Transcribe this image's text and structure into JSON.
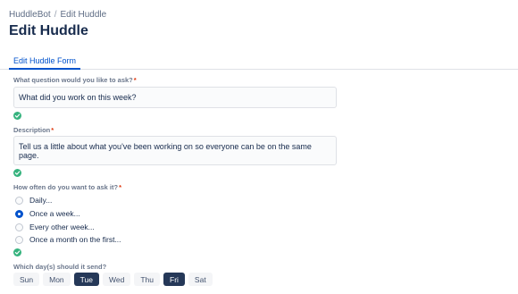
{
  "breadcrumb": {
    "root": "HuddleBot",
    "separator": "/",
    "current": "Edit Huddle"
  },
  "page": {
    "title": "Edit Huddle"
  },
  "tabs": [
    {
      "label": "Edit Huddle Form",
      "active": true
    }
  ],
  "question": {
    "label": "What question would you like to ask?",
    "required_mark": "*",
    "value": "What did you work on this week?",
    "valid": true
  },
  "description": {
    "label": "Description",
    "required_mark": "*",
    "value": "Tell us a little about what you've been working on so everyone can be on the same page.",
    "valid": true
  },
  "frequency": {
    "label": "How often do you want to ask it?",
    "required_mark": "*",
    "options": [
      {
        "label": "Daily...",
        "selected": false
      },
      {
        "label": "Once a week...",
        "selected": true
      },
      {
        "label": "Every other week...",
        "selected": false
      },
      {
        "label": "Once a month on the first...",
        "selected": false
      }
    ],
    "valid": true
  },
  "days": {
    "label": "Which day(s) should it send?",
    "options": [
      {
        "label": "Sun",
        "selected": false
      },
      {
        "label": "Mon",
        "selected": false
      },
      {
        "label": "Tue",
        "selected": true
      },
      {
        "label": "Wed",
        "selected": false
      },
      {
        "label": "Thu",
        "selected": false
      },
      {
        "label": "Fri",
        "selected": true
      },
      {
        "label": "Sat",
        "selected": false
      }
    ]
  },
  "colors": {
    "accent": "#0052cc",
    "success": "#36b37e",
    "required": "#de350b",
    "selected_day": "#253858"
  },
  "icons": {
    "valid": "check-circle-icon"
  }
}
